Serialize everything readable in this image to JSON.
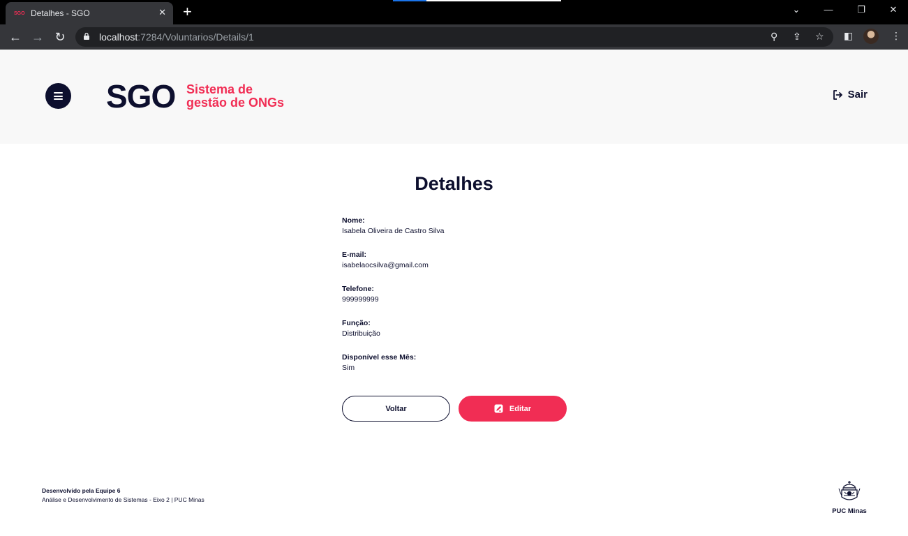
{
  "browser": {
    "tab_favicon": "SGO",
    "tab_title": "Detalhes - SGO",
    "new_tab": "+",
    "url_host": "localhost",
    "url_path": ":7284/Voluntarios/Details/1"
  },
  "header": {
    "logo": "SGO",
    "subtitle_line1": "Sistema de",
    "subtitle_line2": "gestão de ONGs",
    "logout_label": "Sair"
  },
  "main": {
    "title": "Detalhes",
    "fields": [
      {
        "label": "Nome:",
        "value": "Isabela Oliveira de Castro Silva"
      },
      {
        "label": "E-mail:",
        "value": "isabelaocsilva@gmail.com"
      },
      {
        "label": "Telefone:",
        "value": "999999999"
      },
      {
        "label": "Função:",
        "value": "Distribuição"
      },
      {
        "label": "Disponível esse Mês:",
        "value": "Sim"
      }
    ],
    "back_button": "Voltar",
    "edit_button": "Editar"
  },
  "footer": {
    "developed_by": "Desenvolvido pela Equipe 6",
    "course": "Análise e Desenvolvimento de Sistemas - Eixo 2 | PUC Minas",
    "university_logo": "PUC Minas"
  },
  "colors": {
    "primary_dark": "#0d0f2e",
    "accent": "#f12d54",
    "header_bg": "#f8f8f8"
  }
}
